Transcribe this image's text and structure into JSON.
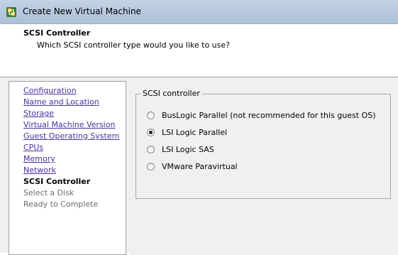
{
  "window": {
    "title": "Create New Virtual Machine",
    "icon": "vm-wizard-icon"
  },
  "header": {
    "title": "SCSI Controller",
    "subtitle": "Which SCSI controller type would you like to use?"
  },
  "nav": {
    "items": [
      {
        "label": "Configuration",
        "state": "link"
      },
      {
        "label": "Name and Location",
        "state": "link"
      },
      {
        "label": "Storage",
        "state": "link"
      },
      {
        "label": "Virtual Machine Version",
        "state": "link"
      },
      {
        "label": "Guest Operating System",
        "state": "link"
      },
      {
        "label": "CPUs",
        "state": "link"
      },
      {
        "label": "Memory",
        "state": "link"
      },
      {
        "label": "Network",
        "state": "link"
      },
      {
        "label": "SCSI Controller",
        "state": "current"
      },
      {
        "label": "Select a Disk",
        "state": "disabled"
      },
      {
        "label": "Ready to Complete",
        "state": "disabled"
      }
    ]
  },
  "scsi": {
    "group_label": "SCSI controller",
    "options": [
      {
        "label": "BusLogic Parallel (not recommended for this guest OS)",
        "checked": false
      },
      {
        "label": "LSI Logic Parallel",
        "checked": true
      },
      {
        "label": "LSI Logic SAS",
        "checked": false
      },
      {
        "label": "VMware Paravirtual",
        "checked": false
      }
    ]
  },
  "colors": {
    "link": "#4a2fa0",
    "titlebar": "#b8c9df",
    "panel": "#f0f0f0"
  }
}
